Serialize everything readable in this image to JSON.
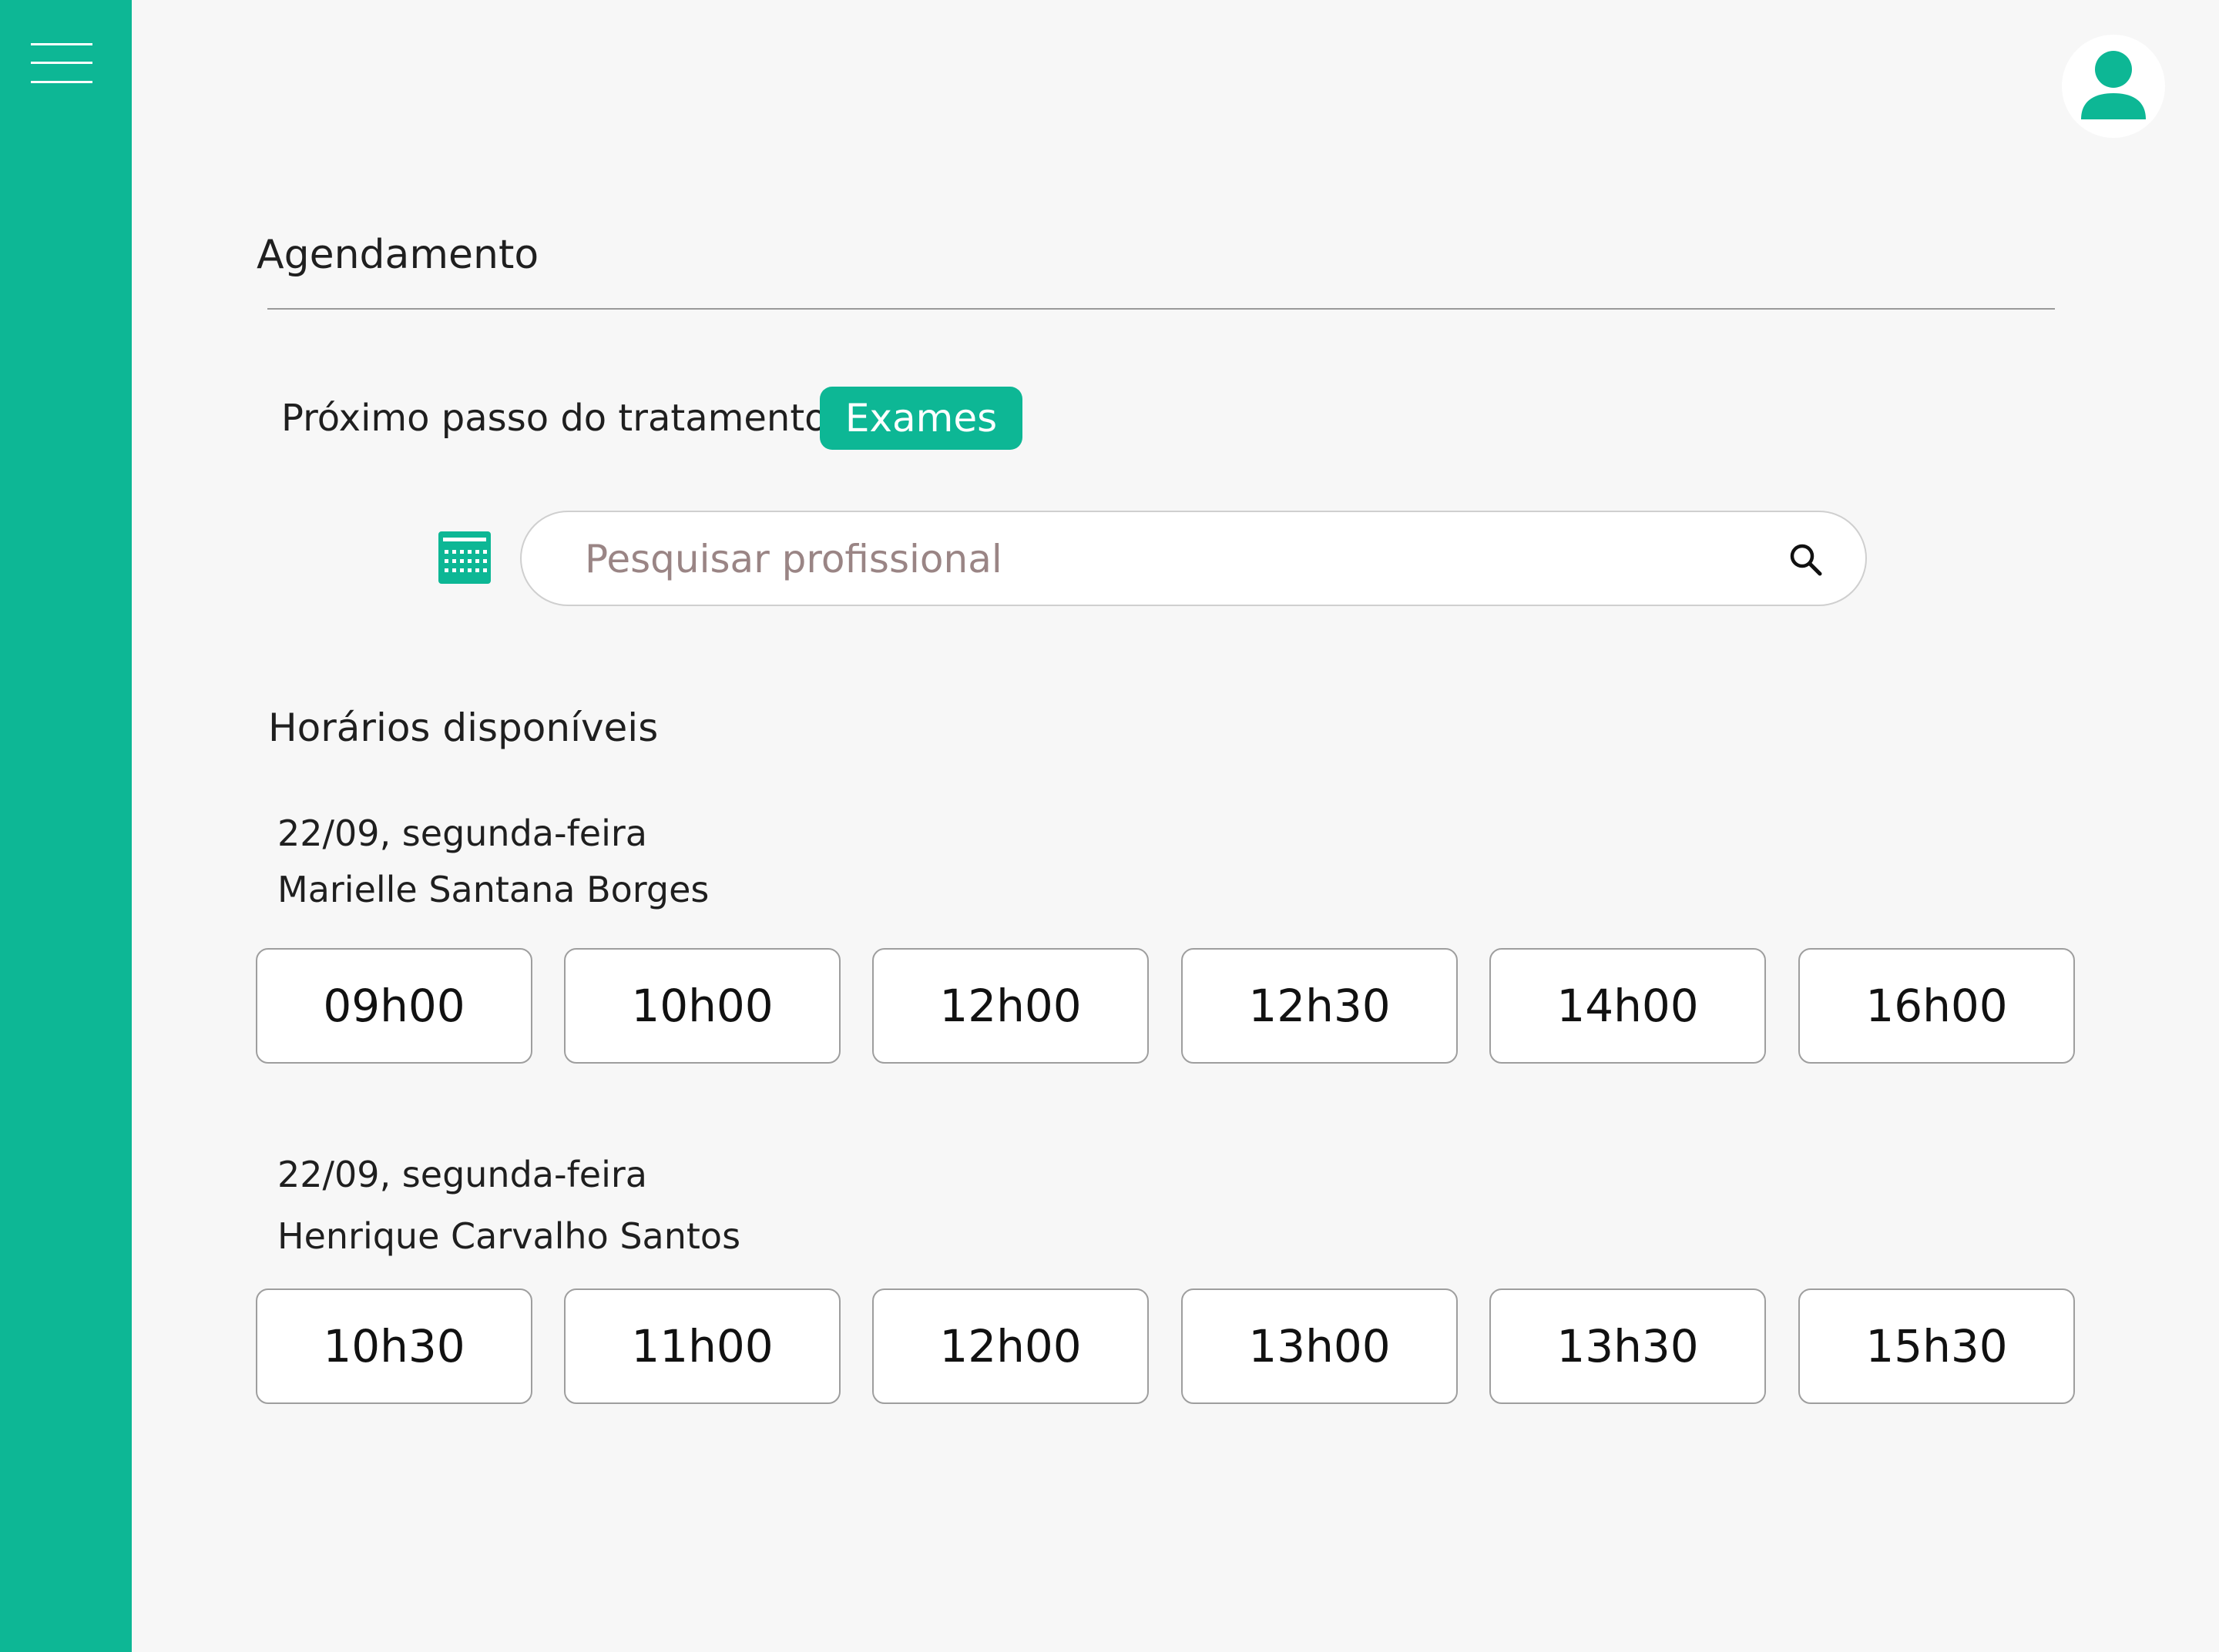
{
  "page": {
    "title": "Agendamento"
  },
  "next_step": {
    "label": "Próximo passo do tratamento:",
    "badge": "Exames"
  },
  "search": {
    "placeholder": "Pesquisar profissional",
    "value": ""
  },
  "icons": {
    "menu": "hamburger-menu-icon",
    "avatar": "user-avatar-icon",
    "calendar": "calendar-icon",
    "search": "magnifier-icon"
  },
  "colors": {
    "accent": "#0db795",
    "background": "#f7f7f7",
    "placeholder": "#9a8585"
  },
  "schedule": {
    "title": "Horários disponíveis",
    "groups": [
      {
        "date": "22/09, segunda-feira",
        "professional": "Marielle Santana Borges",
        "slots": [
          "09h00",
          "10h00",
          "12h00",
          "12h30",
          "14h00",
          "16h00"
        ]
      },
      {
        "date": "22/09, segunda-feira",
        "professional": "Henrique Carvalho Santos",
        "slots": [
          "10h30",
          "11h00",
          "12h00",
          "13h00",
          "13h30",
          "15h30"
        ]
      }
    ]
  }
}
